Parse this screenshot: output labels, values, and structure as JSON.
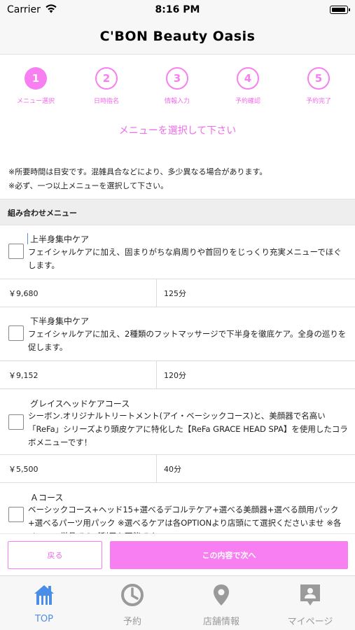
{
  "status_bar": {
    "carrier": "Carrier",
    "time": "8:16 PM"
  },
  "nav": {
    "title": "C'BON Beauty Oasis"
  },
  "steps": [
    {
      "number": "1",
      "label": "メニュー選択",
      "active": true
    },
    {
      "number": "2",
      "label": "日時指名",
      "active": false
    },
    {
      "number": "3",
      "label": "情報入力",
      "active": false
    },
    {
      "number": "4",
      "label": "予約確認",
      "active": false
    },
    {
      "number": "5",
      "label": "予約完了",
      "active": false
    }
  ],
  "instruction": "メニューを選択して下さい",
  "notes": [
    "※所要時間は目安です。混雑具合などにより、多少異なる場合があります。",
    "※必ず、一つ以上メニューを選択して下さい。"
  ],
  "section_header": "組み合わせメニュー",
  "menu_items": [
    {
      "title": "上半身集中ケア",
      "description": "フェイシャルケアに加え、固まりがちな肩周りや首回りをじっくり充実メニューでほぐします。",
      "price": "￥9,680",
      "duration": "125分",
      "checked": false
    },
    {
      "title": "下半身集中ケア",
      "description": "フェイシャルケアに加え、2種類のフットマッサージで下半身を徹底ケア。全身の巡りを促します。",
      "price": "￥9,152",
      "duration": "120分",
      "checked": false
    },
    {
      "title": "グレイスヘッドケアコース",
      "description": "シーボン.オリジナルトリートメント(アイ・ベーシックコース)と、美顔器で名高い「ReFa」シリーズより頭皮ケアに特化した【ReFa GRACE HEAD SPA】を使用したコラボメニューです！",
      "price": "￥5,500",
      "duration": "40分",
      "checked": false
    },
    {
      "title": "Ａコース",
      "description": "ベーシックコース+ヘッド15+選べるデコルテケア+選べる美顔器+選べる顔用パック+選べるパーツ用パック ※選べるケアは各OPTIONより店頭にて選択くださいませ ※各メニュー単品でのご利用も可能です",
      "price": "",
      "duration": "",
      "checked": false
    }
  ],
  "actions": {
    "back_label": "戻る",
    "next_label": "この内容で次へ"
  },
  "tabs": [
    {
      "label": "TOP",
      "icon": "home-icon",
      "active": true
    },
    {
      "label": "予約",
      "icon": "clock-icon",
      "active": false
    },
    {
      "label": "店舗情報",
      "icon": "map-pin-icon",
      "active": false
    },
    {
      "label": "マイページ",
      "icon": "profile-icon",
      "active": false
    }
  ],
  "colors": {
    "accent": "#f77ff1",
    "tab_active": "#4b8ee8",
    "tab_inactive": "#9a9a9a"
  }
}
